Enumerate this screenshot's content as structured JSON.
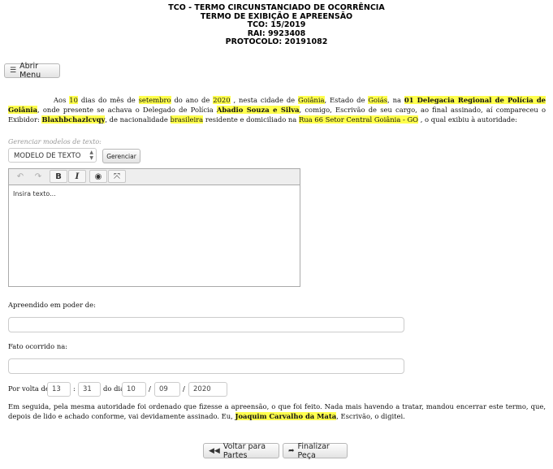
{
  "header": {
    "line1": "TCO - TERMO CIRCUNSTANCIADO DE OCORRÊNCIA",
    "line2": "TERMO DE EXIBIÇÃO E APREENSÃO",
    "line3": "TCO: 15/2019",
    "line4": "RAI: 9923408",
    "line5": "PROTOCOLO: 20191082"
  },
  "menu": {
    "label": "Abrir Menu",
    "icon": "list-icon"
  },
  "intro": {
    "t1": "Aos ",
    "dias": "10",
    "t2": " dias do mês de ",
    "mes": "setembro",
    "t3": " do ano de ",
    "ano": "2020",
    "t4": " , nesta cidade de ",
    "cidade": "Goiânia",
    "t5": ", Estado de ",
    "estado": "Goiás",
    "t6": ", na ",
    "delegacia": "01 Delegacia Regional de Polícia de Goiânia",
    "t7": ", onde presente se achava o Delegado de Polícia ",
    "delegado": "Abadio Souza e Silva",
    "t8": ", comigo, Escrivão de seu cargo, ao final assinado, aí compareceu o Exibidor: ",
    "exibidor": "Blaxhbchazlcvqy",
    "t9": ", de nacionalidade ",
    "nacionalidade": "brasileira",
    "t10": " residente e domiciliado na ",
    "endereco": "Rua 66 Setor Central Goiânia - GO",
    "t11": " , o qual exibiu à autoridade:"
  },
  "templates": {
    "label": "Gerenciar modelos de texto:",
    "select_value": "MODELO DE TEXTO",
    "manage_button": "Gerenciar"
  },
  "editor": {
    "placeholder": "Insira texto..."
  },
  "fields": {
    "apreendido_label": "Apreendido em poder de:",
    "fato_label": "Fato ocorrido na:",
    "volta_label": "Por volta de:",
    "hora": "13",
    "minuto": "31",
    "do_dia_label": "do dia",
    "dia": "10",
    "mes": "09",
    "ano": "2020",
    "sep_colon": ":",
    "sep_slash": "/"
  },
  "closing": {
    "t1": "Em seguida, pela mesma autoridade foi ordenado que fizesse a apreensão, o que foi feito. Nada mais havendo a tratar, mandou encerrar este termo, que, depois de lido e achado conforme, vai devidamente assinado. Eu, ",
    "escrivao": "Joaquim Carvalho da Mata",
    "t2": ", Escrivão, o digitei."
  },
  "buttons": {
    "voltar": "Voltar para Partes",
    "finalizar": "Finalizar Peça"
  }
}
